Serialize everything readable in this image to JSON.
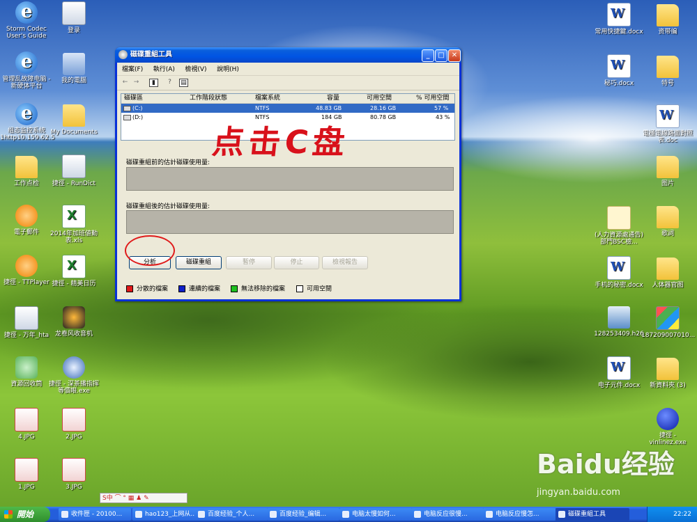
{
  "desktop_icons_left": [
    {
      "label": "Storm Codec User's Guide",
      "icon": "ie-icon"
    },
    {
      "label": "管理乱故障电脑 - 新硬体平台",
      "icon": "ie-icon"
    },
    {
      "label": "组态监控系统 1http10.159.62.5",
      "icon": "ie-icon"
    },
    {
      "label": "工作点检",
      "icon": "folder-icon"
    },
    {
      "label": "電子郵件",
      "icon": "outlook-icon"
    },
    {
      "label": "捷徑 - TTPlayer",
      "icon": "ttplayer-icon"
    },
    {
      "label": "捷徑 - 万年_hta",
      "icon": "shortcut-icon"
    },
    {
      "label": "資源回收筒",
      "icon": "recycle-bin-icon"
    },
    {
      "label": "4.JPG",
      "icon": "jpg-icon"
    },
    {
      "label": "1.JPG",
      "icon": "jpg-icon"
    }
  ],
  "desktop_icons_left2": [
    {
      "label": "登录",
      "icon": "login-icon"
    },
    {
      "label": "我的電腦",
      "icon": "computer-icon"
    },
    {
      "label": "My Documents",
      "icon": "folder-icon"
    },
    {
      "label": "捷徑 - RunDict",
      "icon": "search-icon"
    },
    {
      "label": "2014年加班値勤表.xls",
      "icon": "excel-icon"
    },
    {
      "label": "捷徑 - 精美日历",
      "icon": "excel-icon"
    },
    {
      "label": "龙卷风收音机",
      "icon": "radio-icon"
    },
    {
      "label": "捷徑 - 深茶播指挥等價眼.exe",
      "icon": "flash-icon"
    },
    {
      "label": "2.JPG",
      "icon": "jpg-icon"
    },
    {
      "label": "3.JPG",
      "icon": "jpg-icon"
    }
  ],
  "desktop_icons_right": [
    {
      "label": "常用快捷鍵.docx",
      "icon": "word-icon"
    },
    {
      "label": "秘巧.docx",
      "icon": "word-icon"
    },
    {
      "label": "電極電線路面對照表.doc",
      "icon": "word-icon"
    },
    {
      "label": "(人力資源處通告)部門BSC檢...",
      "icon": "mail-icon"
    },
    {
      "label": "手机的秘密.docx",
      "icon": "word-icon"
    },
    {
      "label": "128253409.h26",
      "icon": "video-icon"
    },
    {
      "label": "电子元件.docx",
      "icon": "word-icon"
    }
  ],
  "desktop_icons_right2": [
    {
      "label": "资带编",
      "icon": "folder-icon"
    },
    {
      "label": "特号",
      "icon": "folder-icon"
    },
    {
      "label": "图片",
      "icon": "folder-icon"
    },
    {
      "label": "歌詞",
      "icon": "folder-icon"
    },
    {
      "label": "人体器官图",
      "icon": "folder-icon"
    },
    {
      "label": "187209007010...",
      "icon": "image-icon"
    },
    {
      "label": "新資料夾 (3)",
      "icon": "folder-icon"
    },
    {
      "label": "捷徑 - vinlinez.exe",
      "icon": "ball-icon"
    }
  ],
  "window": {
    "title": "磁碟重組工具",
    "menu": [
      "檔案(F)",
      "執行(A)",
      "檢視(V)",
      "說明(H)"
    ],
    "columns": [
      "磁碟區",
      "工作階段狀態",
      "檔案系統",
      "容量",
      "可用空間",
      "% 可用空間"
    ],
    "rows": [
      {
        "volume": "(C:)",
        "status": "",
        "fs": "NTFS",
        "capacity": "48.83 GB",
        "free": "28.16 GB",
        "pct": "57 %"
      },
      {
        "volume": "(D:)",
        "status": "",
        "fs": "NTFS",
        "capacity": "184 GB",
        "free": "80.78 GB",
        "pct": "43 %"
      }
    ],
    "before_label": "磁碟重組前的估計磁碟使用量:",
    "after_label": "磁碟重組後的估計磁碟使用量:",
    "buttons": {
      "analyze": "分析",
      "defrag": "磁碟重組",
      "pause": "暫停",
      "stop": "停止",
      "report": "檢視報告"
    },
    "legend": [
      {
        "label": "分散的檔案",
        "color": "#e01818"
      },
      {
        "label": "連續的檔案",
        "color": "#1020c8"
      },
      {
        "label": "無法移除的檔案",
        "color": "#20c020"
      },
      {
        "label": "可用空間",
        "color": "#ffffff"
      }
    ]
  },
  "annotation": "点击C盘",
  "ime_bar": "S中 ⌒ ° ▦ ♟ ✎",
  "taskbar": {
    "start": "開始",
    "tasks": [
      "收件匣 - 20100...",
      "hao123_上网从...",
      "百度经验_个人...",
      "百度经验_编辑...",
      "电脑太慢如何...",
      "电脑反应很慢...",
      "电脑反应慢怎...",
      "磁碟重組工具"
    ],
    "clock": "22:22"
  },
  "watermark": {
    "brand": "Baidu经验",
    "url": "jingyan.baidu.com"
  }
}
